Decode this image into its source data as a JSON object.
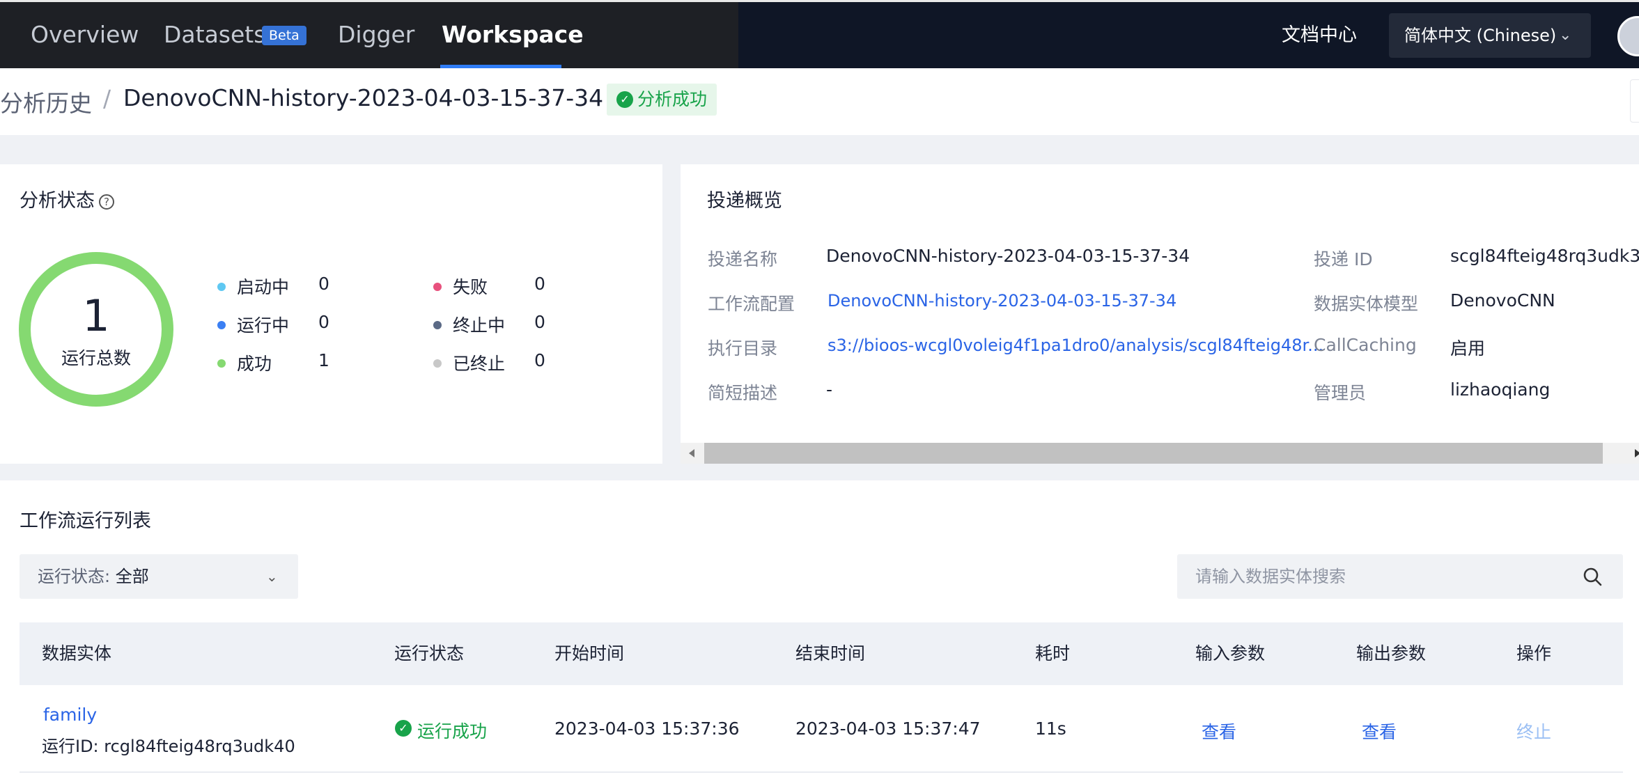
{
  "nav": {
    "items": [
      "Overview",
      "Datasets",
      "Digger",
      "Workspace"
    ],
    "beta_badge": "Beta",
    "active": "Workspace",
    "docs_link": "文档中心",
    "language": "简体中文 (Chinese)"
  },
  "breadcrumb": {
    "parent": "分析历史",
    "separator": "/",
    "current": "DenovoCNN-history-2023-04-03-15-37-34",
    "status": "分析成功"
  },
  "analysis_status": {
    "title": "分析状态",
    "total": "1",
    "total_label": "运行总数",
    "legend": [
      {
        "label": "启动中",
        "value": "0",
        "color": "#5fc8f2"
      },
      {
        "label": "运行中",
        "value": "0",
        "color": "#3b7ff3"
      },
      {
        "label": "成功",
        "value": "1",
        "color": "#85d971"
      },
      {
        "label": "失败",
        "value": "0",
        "color": "#e8517d"
      },
      {
        "label": "终止中",
        "value": "0",
        "color": "#5b6a86"
      },
      {
        "label": "已终止",
        "value": "0",
        "color": "#c8c8c8"
      }
    ]
  },
  "overview": {
    "title": "投递概览",
    "left": [
      {
        "label": "投递名称",
        "value": "DenovoCNN-history-2023-04-03-15-37-34"
      },
      {
        "label": "工作流配置",
        "value": "DenovoCNN-history-2023-04-03-15-37-34"
      },
      {
        "label": "执行目录",
        "value": "s3://bioos-wcgl0voleig4f1pa1dro0/analysis/scgl84fteig48r..."
      },
      {
        "label": "简短描述",
        "value": "-"
      }
    ],
    "right": [
      {
        "label": "投递 ID",
        "value": "scgl84fteig48rq3udk3"
      },
      {
        "label": "数据实体模型",
        "value": "DenovoCNN"
      },
      {
        "label": "CallCaching",
        "value": "启用"
      },
      {
        "label": "管理员",
        "value": "lizhaoqiang"
      }
    ]
  },
  "runs": {
    "title": "工作流运行列表",
    "filter_label": "运行状态:",
    "filter_value": "全部",
    "search_placeholder": "请输入数据实体搜索",
    "columns": [
      "数据实体",
      "运行状态",
      "开始时间",
      "结束时间",
      "耗时",
      "输入参数",
      "输出参数",
      "操作"
    ],
    "rows": [
      {
        "entity": "family",
        "run_id": "运行ID: rcgl84fteig48rq3udk40",
        "status": "运行成功",
        "start": "2023-04-03 15:37:36",
        "end": "2023-04-03 15:37:47",
        "duration": "11s",
        "input": "查看",
        "output": "查看",
        "action": "终止"
      }
    ]
  }
}
